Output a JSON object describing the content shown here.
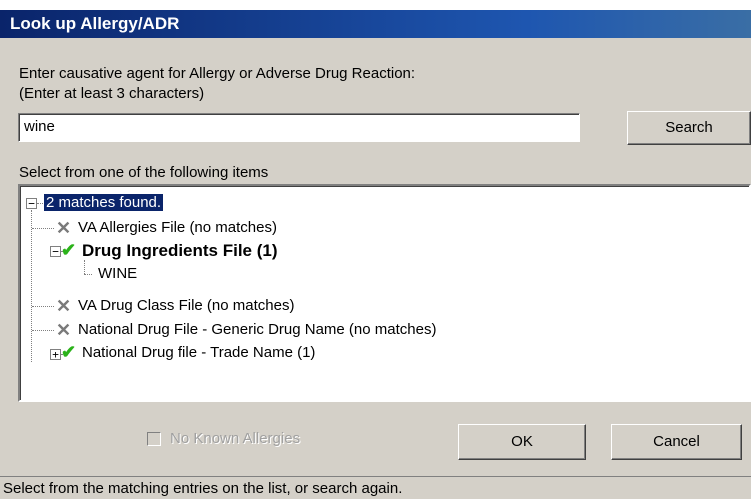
{
  "window": {
    "title": "Look up Allergy/ADR"
  },
  "prompt": {
    "line1": "Enter causative agent for Allergy or Adverse Drug Reaction:",
    "line2": "(Enter at least 3 characters)"
  },
  "search": {
    "value": "wine",
    "button_label": "Search"
  },
  "list": {
    "label": "Select from one of the following items",
    "root": "2 matches found.",
    "items": [
      {
        "label": "VA Allergies File  (no matches)",
        "icon": "x-icon"
      },
      {
        "label": "Drug Ingredients File  (1)",
        "icon": "check-icon",
        "bold": true,
        "children": [
          "WINE"
        ]
      },
      {
        "label": "VA Drug Class File  (no matches)",
        "icon": "x-icon"
      },
      {
        "label": "National Drug File - Generic Drug Name  (no matches)",
        "icon": "x-icon"
      },
      {
        "label": "National Drug file - Trade Name  (1)",
        "icon": "check-icon"
      }
    ]
  },
  "nka": {
    "label": "No Known Allergies",
    "checked": false,
    "enabled": false
  },
  "buttons": {
    "ok": "OK",
    "cancel": "Cancel"
  },
  "status": "Select from the matching entries on the list, or search again.",
  "colors": {
    "title_bg": "#0a246a",
    "check": "#2bb21a",
    "face": "#d4d0c8"
  }
}
